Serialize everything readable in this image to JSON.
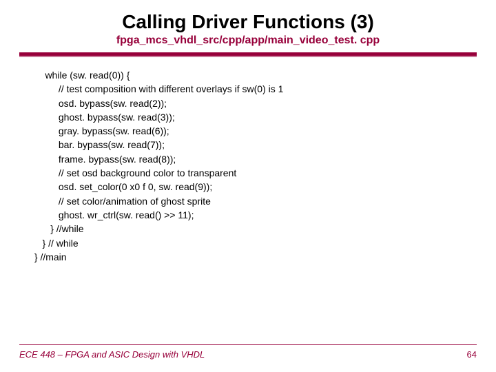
{
  "title": "Calling Driver Functions (3)",
  "subtitle": "fpga_mcs_vhdl_src/cpp/app/main_video_test. cpp",
  "code": "     while (sw. read(0)) {\n          // test composition with different overlays if sw(0) is 1\n          osd. bypass(sw. read(2));\n          ghost. bypass(sw. read(3));\n          gray. bypass(sw. read(6));\n          bar. bypass(sw. read(7));\n          frame. bypass(sw. read(8));\n          // set osd background color to transparent\n          osd. set_color(0 x0 f 0, sw. read(9));\n          // set color/animation of ghost sprite\n          ghost. wr_ctrl(sw. read() >> 11);\n       } //while\n    } // while\n } //main",
  "footer": {
    "left": "ECE 448 – FPGA and ASIC Design with VHDL",
    "right": "64"
  },
  "colors": {
    "accent": "#97003a"
  }
}
